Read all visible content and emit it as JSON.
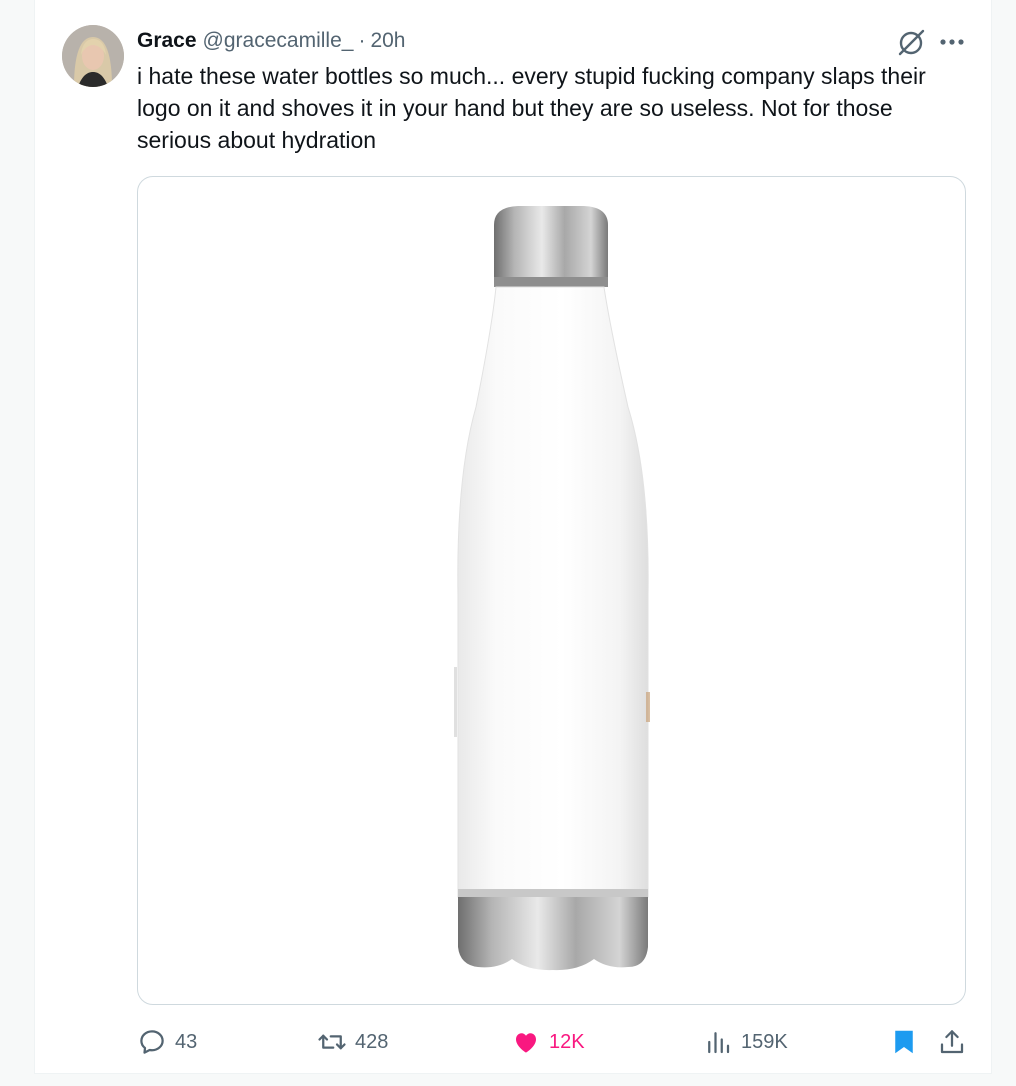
{
  "tweet": {
    "author_name": "Grace",
    "author_handle": "@gracecamille_",
    "separator": "·",
    "timestamp": "20h",
    "text": "i hate these water bottles so much... every stupid fucking company slaps their logo on it and shoves it in your hand but they are so useless. Not for those serious about hydration"
  },
  "icons": {
    "avatar": "avatar",
    "grok": "grok-icon",
    "more": "more-icon",
    "reply": "reply-icon",
    "retweet": "retweet-icon",
    "like": "heart-icon",
    "views": "views-icon",
    "bookmark": "bookmark-icon",
    "share": "share-icon"
  },
  "media": {
    "subject": "white stainless steel water bottle"
  },
  "actions": {
    "replies": "43",
    "retweets": "428",
    "likes": "12K",
    "views": "159K",
    "liked": true,
    "bookmarked": true
  },
  "colors": {
    "text": "#0f1419",
    "secondary": "#536471",
    "like": "#f91880",
    "bookmark": "#1d9bf0",
    "border": "#cfd9de"
  }
}
